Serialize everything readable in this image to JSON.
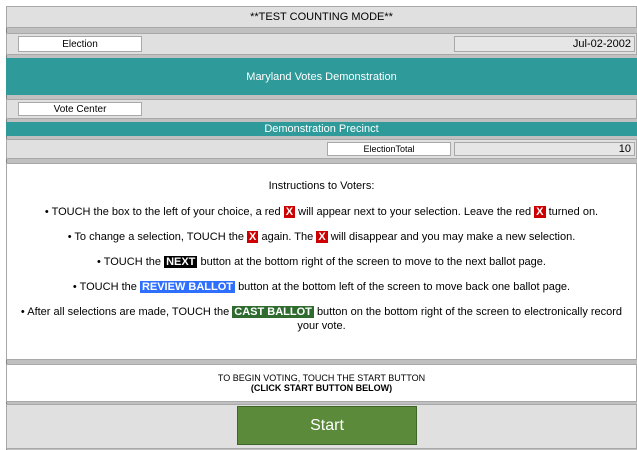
{
  "header": {
    "mode_title": "**TEST COUNTING MODE**"
  },
  "election_row": {
    "label": "Election",
    "date": "Jul-02-2002"
  },
  "banner": {
    "title": "Maryland Votes Demonstration"
  },
  "vote_center_row": {
    "label": "Vote Center"
  },
  "precinct": {
    "name": "Demonstration Precinct"
  },
  "totals": {
    "label": "ElectionTotal",
    "value": "10"
  },
  "instructions": {
    "title": "Instructions to Voters:",
    "bullet": "•",
    "mark": "X",
    "line1_pre": "TOUCH the box to the left of your choice, a red",
    "line1_mid": "will appear next to your selection. Leave the red",
    "line1_post": "turned on.",
    "line2_pre": "To change a selection, TOUCH the",
    "line2_mid": "again. The",
    "line2_post": "will disappear and you may make a new selection.",
    "line3_pre": "TOUCH the",
    "line3_tag": "NEXT",
    "line3_post": "button at the bottom right of the screen to move to the next ballot page.",
    "line4_pre": "TOUCH the",
    "line4_tag": "REVIEW BALLOT",
    "line4_post": "button at the bottom left of the screen to move back one ballot page.",
    "line5_pre": "After all selections are made, TOUCH the",
    "line5_tag": "CAST BALLOT",
    "line5_post": "button on the bottom right of the screen to electronically record",
    "line5_cont": "your vote."
  },
  "begin": {
    "line1": "TO BEGIN VOTING, TOUCH THE START BUTTON",
    "line2": "(CLICK START BUTTON BELOW)"
  },
  "start_button": {
    "label": "Start"
  },
  "colors": {
    "teal": "#2e9a9a",
    "start_green": "#5b8a3a",
    "mark_red": "#cc0000"
  }
}
